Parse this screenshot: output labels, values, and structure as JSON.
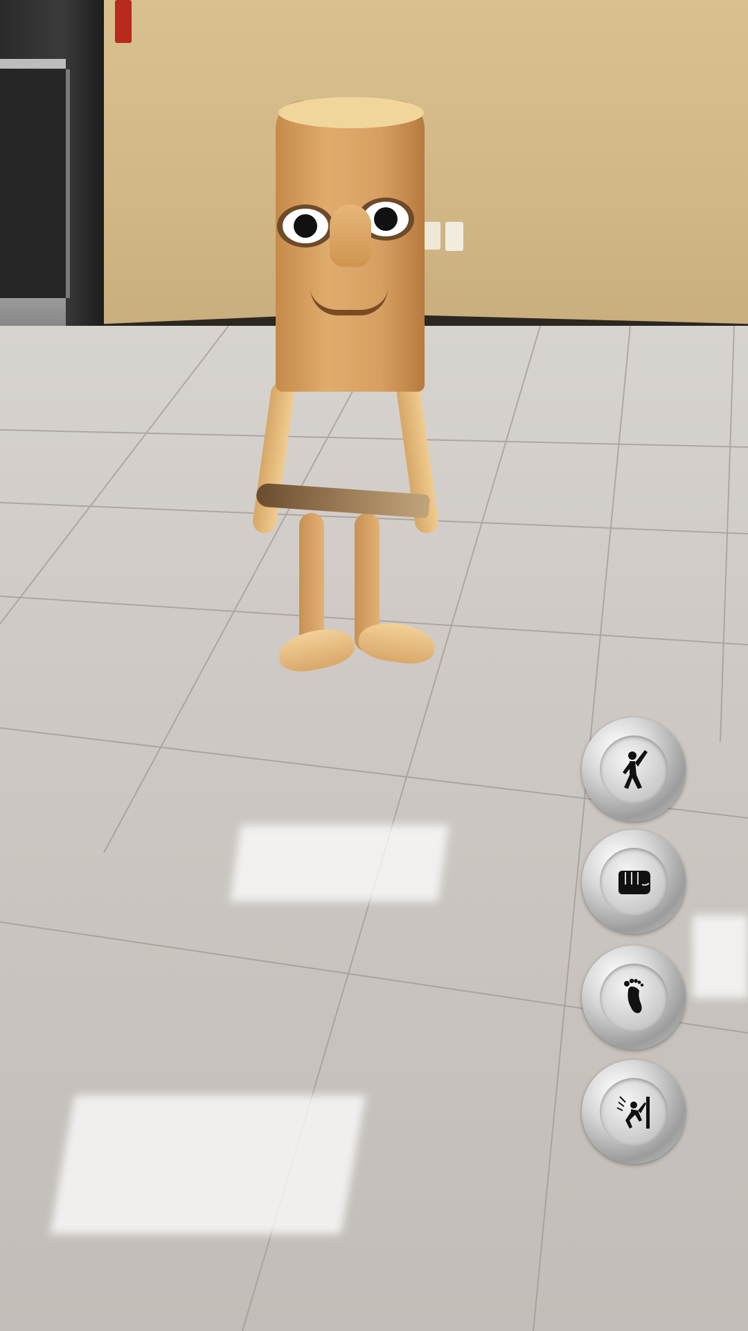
{
  "scene": {
    "background": "ar-camera-feed",
    "wall_color": "#d5bc8a",
    "floor_color": "#cdc8c3"
  },
  "character": {
    "name": "wooden-stick-figure",
    "prop": "wooden-bat"
  },
  "actions": [
    {
      "id": "celebrate",
      "icon": "celebrate-icon"
    },
    {
      "id": "punch",
      "icon": "punch-icon"
    },
    {
      "id": "kick",
      "icon": "footprint-icon"
    },
    {
      "id": "fall",
      "icon": "fall-icon"
    }
  ]
}
